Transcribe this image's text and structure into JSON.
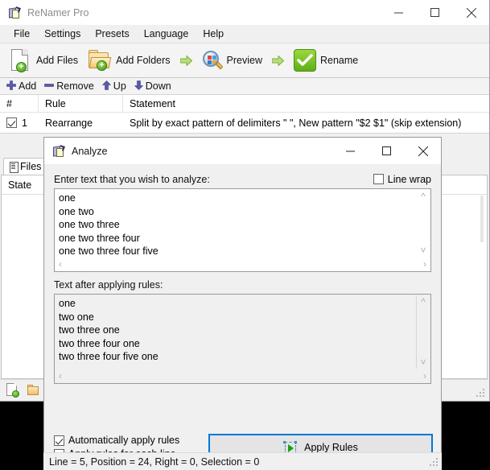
{
  "main_window": {
    "title": "ReNamer Pro",
    "icon": "renamer-app-icon",
    "window_controls": {
      "minimize": "minimize-icon",
      "maximize": "maximize-icon",
      "close": "close-icon"
    },
    "menu": [
      {
        "label": "File"
      },
      {
        "label": "Settings"
      },
      {
        "label": "Presets"
      },
      {
        "label": "Language"
      },
      {
        "label": "Help"
      }
    ],
    "toolbar": [
      {
        "label": "Add Files",
        "icon": "add-files-icon"
      },
      {
        "label": "Add Folders",
        "icon": "add-folders-icon"
      },
      {
        "label": "Preview",
        "icon": "preview-magnifier-icon"
      },
      {
        "label": "Rename",
        "icon": "rename-checkmark-icon"
      }
    ],
    "rules_toolbar": [
      {
        "label": "Add",
        "icon": "plus-icon"
      },
      {
        "label": "Remove",
        "icon": "minus-icon"
      },
      {
        "label": "Up",
        "icon": "arrow-up-icon"
      },
      {
        "label": "Down",
        "icon": "arrow-down-icon"
      }
    ],
    "rules_table": {
      "columns": [
        "#",
        "Rule",
        "Statement"
      ],
      "rows": [
        {
          "checked": true,
          "num": "1",
          "rule": "Rearrange",
          "statement": "Split by exact pattern of delimiters \" \", New pattern \"$2 $1\" (skip extension)"
        }
      ]
    },
    "files_pane": {
      "tab_label": "Files",
      "tab_icon": "files-tab-icon",
      "columns": [
        "State"
      ],
      "bottom_icons": [
        "add-file-icon",
        "add-folder-icon"
      ]
    }
  },
  "analyze_dialog": {
    "title": "Analyze",
    "icon": "renamer-app-icon",
    "window_controls": {
      "minimize": "minimize-icon",
      "maximize": "maximize-icon",
      "close": "close-icon"
    },
    "input_label": "Enter text that you wish to analyze:",
    "line_wrap": {
      "label": "Line wrap",
      "checked": false
    },
    "input_text": "one\none two\none two three\none two three four\none two three four five",
    "output_label": "Text after applying rules:",
    "output_text": "one\ntwo one\ntwo three one\ntwo three four one\ntwo three four five one",
    "options": [
      {
        "label": "Automatically apply rules",
        "checked": true
      },
      {
        "label": "Apply rules for each line",
        "checked": true
      }
    ],
    "apply_button": {
      "label": "Apply Rules",
      "icon": "apply-rules-icon"
    },
    "status": "Line = 5, Position = 24, Right = 0, Selection = 0"
  },
  "colors": {
    "accent": "#0078d7",
    "window_bg": "#f0f0f0",
    "titlebar_bg": "#ffffff",
    "green": "#5fae16",
    "title_text_inactive": "#8d8d8d"
  }
}
